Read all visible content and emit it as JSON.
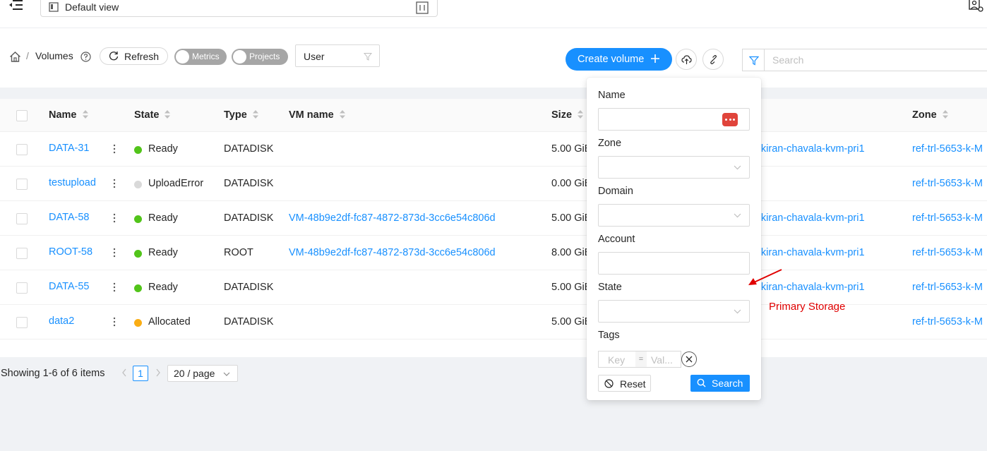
{
  "header": {
    "view_select_label": "Default view"
  },
  "breadcrumb": {
    "separator": "/",
    "current": "Volumes"
  },
  "toolbar": {
    "refresh_label": "Refresh",
    "metrics_label": "Metrics",
    "projects_label": "Projects",
    "user_select_value": "User",
    "create_label": "Create volume",
    "search_placeholder": "Search"
  },
  "table": {
    "headers": {
      "name": "Name",
      "state": "State",
      "type": "Type",
      "vm_name": "VM name",
      "size": "Size",
      "zone": "Zone"
    },
    "rows": [
      {
        "name": "DATA-31",
        "state": "Ready",
        "state_color": "#52c41a",
        "type": "DATADISK",
        "vm_name": "",
        "size": "5.00 GiB",
        "storage": "7-kiran-chavala-kvm-pri1",
        "zone": "ref-trl-5653-k-M"
      },
      {
        "name": "testupload",
        "state": "UploadError",
        "state_color": "#d9d9d9",
        "type": "DATADISK",
        "vm_name": "",
        "size": "0.00 GiB",
        "storage": "",
        "zone": "ref-trl-5653-k-M"
      },
      {
        "name": "DATA-58",
        "state": "Ready",
        "state_color": "#52c41a",
        "type": "DATADISK",
        "vm_name": "VM-48b9e2df-fc87-4872-873d-3cc6e54c806d",
        "size": "5.00 GiB",
        "storage": "7-kiran-chavala-kvm-pri1",
        "zone": "ref-trl-5653-k-M"
      },
      {
        "name": "ROOT-58",
        "state": "Ready",
        "state_color": "#52c41a",
        "type": "ROOT",
        "vm_name": "VM-48b9e2df-fc87-4872-873d-3cc6e54c806d",
        "size": "8.00 GiB",
        "storage": "7-kiran-chavala-kvm-pri1",
        "zone": "ref-trl-5653-k-M"
      },
      {
        "name": "DATA-55",
        "state": "Ready",
        "state_color": "#52c41a",
        "type": "DATADISK",
        "vm_name": "",
        "size": "5.00 GiB",
        "storage": "7-kiran-chavala-kvm-pri1",
        "zone": "ref-trl-5653-k-M"
      },
      {
        "name": "data2",
        "state": "Allocated",
        "state_color": "#faad14",
        "type": "DATADISK",
        "vm_name": "",
        "size": "5.00 GiB",
        "storage": "",
        "zone": "ref-trl-5653-k-M"
      }
    ]
  },
  "pagination": {
    "info": "Showing 1-6 of 6 items",
    "current_page": "1",
    "page_size": "20 / page"
  },
  "filter_popover": {
    "name_label": "Name",
    "zone_label": "Zone",
    "domain_label": "Domain",
    "account_label": "Account",
    "state_label": "State",
    "tags_label": "Tags",
    "tag_key_placeholder": "Key",
    "tag_separator": "=",
    "tag_value_placeholder": "Val...",
    "reset_label": "Reset",
    "search_label": "Search"
  },
  "annotation": {
    "text": "Primary Storage",
    "color": "#e00000"
  },
  "colors": {
    "primary": "#1890ff",
    "ready": "#52c41a",
    "allocated": "#faad14",
    "upload_error": "#d9d9d9"
  }
}
